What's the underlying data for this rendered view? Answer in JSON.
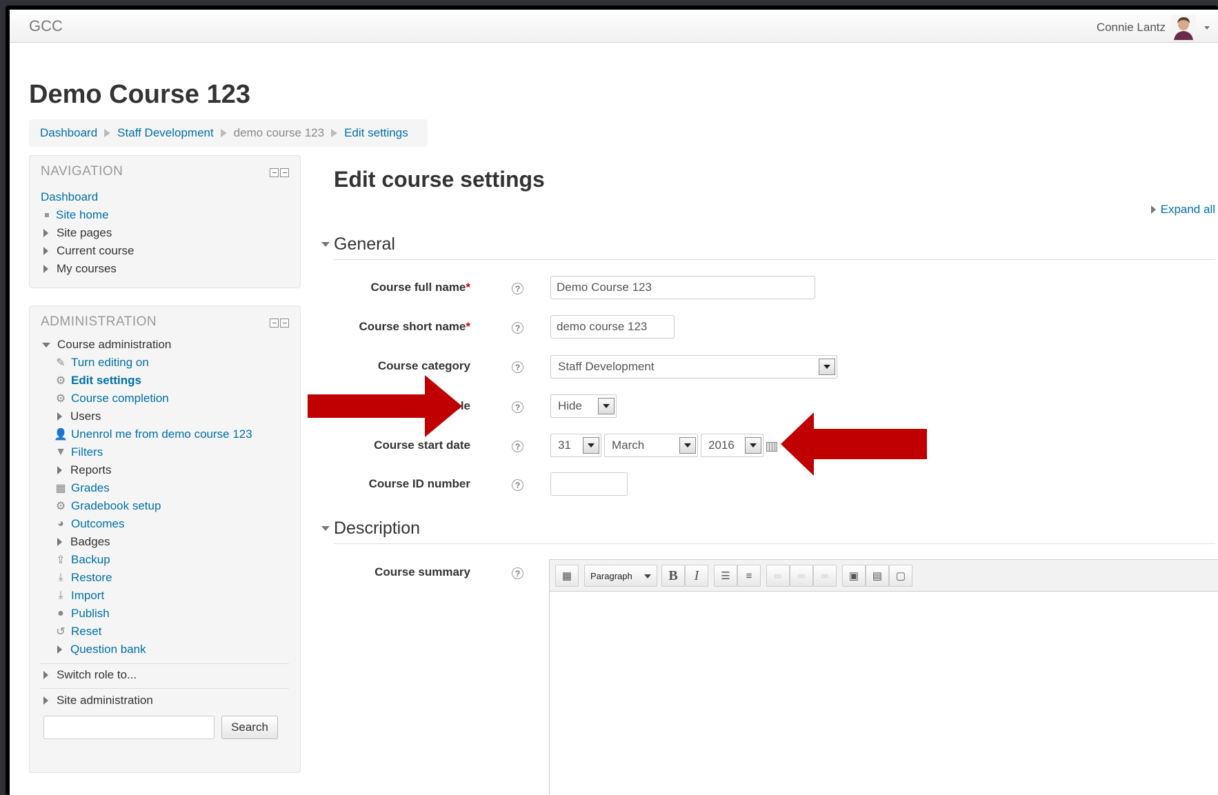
{
  "navbar": {
    "brand": "GCC",
    "username": "Connie Lantz"
  },
  "page_title": "Demo Course 123",
  "breadcrumb": [
    "Dashboard",
    "Staff Development",
    "demo course 123",
    "Edit settings"
  ],
  "navigation": {
    "heading": "NAVIGATION",
    "dashboard": "Dashboard",
    "items": [
      "Site home",
      "Site pages",
      "Current course",
      "My courses"
    ]
  },
  "administration": {
    "heading": "ADMINISTRATION",
    "course_admin": "Course administration",
    "items": [
      "Turn editing on",
      "Edit settings",
      "Course completion",
      "Users",
      "Unenrol me from demo course 123",
      "Filters",
      "Reports",
      "Grades",
      "Gradebook setup",
      "Outcomes",
      "Badges",
      "Backup",
      "Restore",
      "Import",
      "Publish",
      "Reset",
      "Question bank"
    ],
    "switch_role": "Switch role to...",
    "site_admin": "Site administration",
    "search_button": "Search"
  },
  "main": {
    "title": "Edit course settings",
    "expand_all": "Expand all",
    "section_general": "General",
    "section_description": "Description",
    "help_glyph": "?",
    "required_marker": "*",
    "fields": {
      "full_name_label": "Course full name",
      "full_name_value": "Demo Course 123",
      "short_name_label": "Course short name",
      "short_name_value": "demo course 123",
      "category_label": "Course category",
      "category_value": "Staff Development",
      "visible_label": "Visible",
      "visible_value": "Hide",
      "start_date_label": "Course start date",
      "start_day": "31",
      "start_month": "March",
      "start_year": "2016",
      "id_number_label": "Course ID number",
      "id_number_value": "",
      "summary_label": "Course summary"
    },
    "editor": {
      "paragraph": "Paragraph",
      "bold": "B",
      "italic": "I"
    }
  },
  "annotations": {
    "arrow_color": "#c00000"
  },
  "colors": {
    "link": "#0070a8",
    "required": "#cc0000"
  }
}
